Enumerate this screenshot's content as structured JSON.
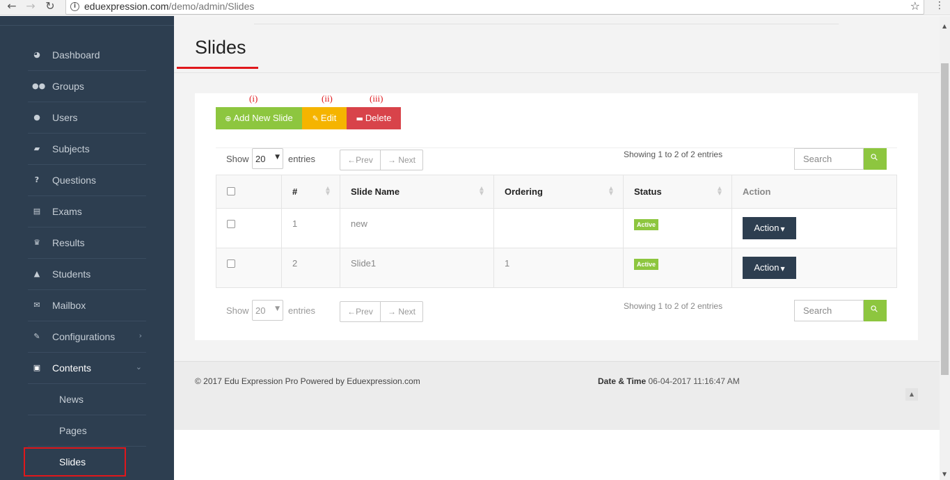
{
  "browser": {
    "url_domain": "eduexpression.com",
    "url_path": "/demo/admin/Slides"
  },
  "sidebar": {
    "items": [
      {
        "label": "Dashboard",
        "icon": "dashboard-icon"
      },
      {
        "label": "Groups",
        "icon": "groups-icon"
      },
      {
        "label": "Users",
        "icon": "user-icon"
      },
      {
        "label": "Subjects",
        "icon": "book-icon"
      },
      {
        "label": "Questions",
        "icon": "question-icon"
      },
      {
        "label": "Exams",
        "icon": "list-icon"
      },
      {
        "label": "Results",
        "icon": "trophy-icon"
      },
      {
        "label": "Students",
        "icon": "graduation-cap-icon"
      },
      {
        "label": "Mailbox",
        "icon": "envelope-icon"
      },
      {
        "label": "Configurations",
        "icon": "wrench-icon"
      },
      {
        "label": "Contents",
        "icon": "newspaper-icon"
      }
    ],
    "subitems": [
      {
        "label": "News"
      },
      {
        "label": "Pages"
      },
      {
        "label": "Slides"
      }
    ]
  },
  "page": {
    "title": "Slides"
  },
  "toolbar": {
    "annotations": [
      "(i)",
      "(ii)",
      "(iii)"
    ],
    "add_label": "Add New Slide",
    "edit_label": "Edit",
    "delete_label": "Delete"
  },
  "controls": {
    "show_label": "Show",
    "entries_label": "entries",
    "page_size": "20",
    "prev_label": "←Prev",
    "next_label": "→ Next",
    "showing_text": "Showing 1 to 2 of 2 entries",
    "search_placeholder": "Search"
  },
  "table": {
    "headers": [
      "#",
      "Slide Name",
      "Ordering",
      "Status",
      "Action"
    ],
    "rows": [
      {
        "num": "1",
        "name": "new",
        "ordering": "",
        "status": "Active",
        "action": "Action"
      },
      {
        "num": "2",
        "name": "Slide1",
        "ordering": "1",
        "status": "Active",
        "action": "Action"
      }
    ]
  },
  "footer": {
    "copyright": "© 2017 Edu Expression Pro Powered by Eduexpression.com",
    "datetime_label": "Date & Time",
    "datetime_value": "06-04-2017 11:16:47 AM"
  },
  "colors": {
    "sidebar_bg": "#2d3e50",
    "accent_green": "#8dc63f",
    "edit_yellow": "#f5b400",
    "delete_red": "#d8434a",
    "annotation_red": "#e0171b"
  }
}
